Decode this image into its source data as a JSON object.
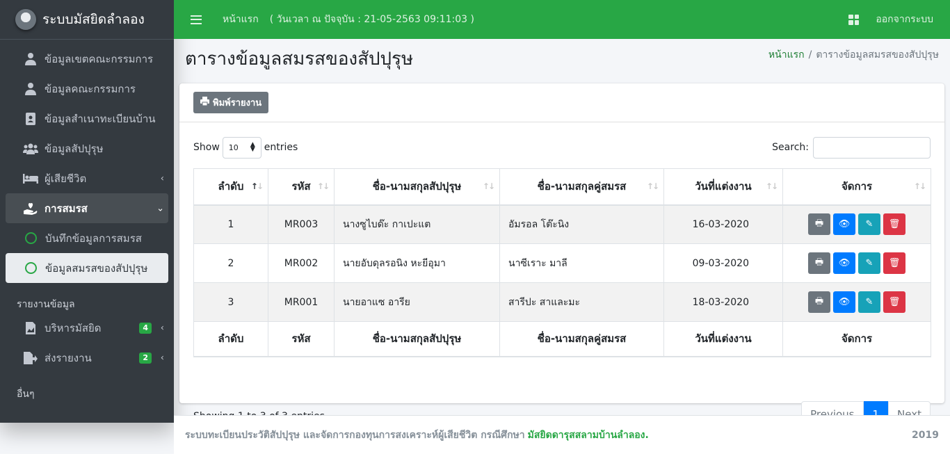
{
  "brand": {
    "title": "ระบบมัสยิดลำลอง"
  },
  "sidebar": {
    "items": [
      {
        "label": "ข้อมูลเขตคณะกรรมการ"
      },
      {
        "label": "ข้อมูลคณะกรรมการ"
      },
      {
        "label": "ข้อมูลสำเนาทะเบียนบ้าน"
      },
      {
        "label": "ข้อมูลสัปปุรุษ"
      },
      {
        "label": "ผู้เสียชีวิต"
      },
      {
        "label": "การสมรส"
      },
      {
        "label": "บันทึกข้อมูลการสมรส"
      },
      {
        "label": "ข้อมูลสมรสของสัปปุรุษ"
      }
    ],
    "header_reports": "รายงานข้อมูล",
    "reports": [
      {
        "label": "บริหารมัสยิด",
        "badge": "4"
      },
      {
        "label": "ส่งรายงาน",
        "badge": "2"
      }
    ],
    "header_other": "อื่นๆ"
  },
  "topbar": {
    "home": "หน้าแรก",
    "time": "( วันเวลา ณ ปัจจุบัน : 21-05-2563 09:11:03 )",
    "logout": "ออกจากระบบ"
  },
  "page": {
    "title": "ตารางข้อมูลสมรสของสัปปุรุษ",
    "breadcrumb_home": "หน้าแรก",
    "breadcrumb_sep": "/",
    "breadcrumb_current": "ตารางข้อมูลสมรสของสัปปุรุษ"
  },
  "card": {
    "print_label": "พิมพ์รายงาน",
    "show_label": "Show",
    "entries_value": "10",
    "entries_label": "entries",
    "search_label": "Search:",
    "search_value": "",
    "columns": [
      "ลำดับ",
      "รหัส",
      "ชื่อ-นามสกุลสัปปุรุษ",
      "ชื่อ-นามสกุลคู่สมรส",
      "วันที่แต่งงาน",
      "จัดการ"
    ],
    "rows": [
      [
        "1",
        "MR003",
        "นางซูไบด๊ะ กาเปะแต",
        "อัมรอล โต๊ะนิง",
        "16-03-2020"
      ],
      [
        "2",
        "MR002",
        "นายอับดุลรอนิง หะยีอุมา",
        "นาซีเราะ มาลี",
        "09-03-2020"
      ],
      [
        "3",
        "MR001",
        "นายอาแซ อารีย",
        "สารีปะ สาและมะ",
        "18-03-2020"
      ]
    ],
    "info": "Showing 1 to 3 of 3 entries",
    "pager": {
      "previous": "Previous",
      "current": "1",
      "next": "Next"
    }
  },
  "footer": {
    "text": "ระบบทะเบียนประวัติสัปปุรุษ และจัดการกองทุนการสงเคราะห์ผู้เสียชีวิต กรณีศึกษา",
    "org": "มัสยิดดารุสสลามบ้านลำลอง.",
    "year": "2019"
  },
  "colors": {
    "primary": "#28a745",
    "sidebar": "#343a40",
    "blue": "#007bff",
    "info": "#17a2b8",
    "danger": "#dc3545",
    "secondary": "#6c757d"
  }
}
